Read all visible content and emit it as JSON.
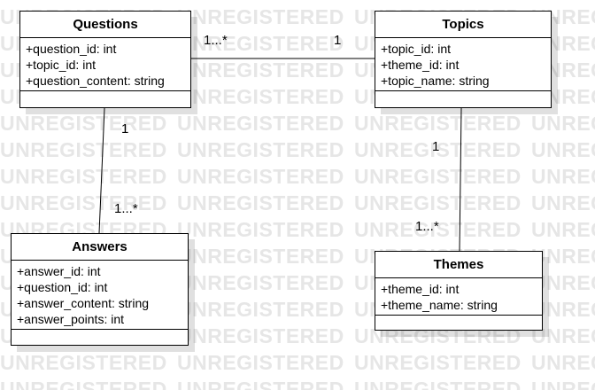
{
  "watermark_text": "UNREGISTERED",
  "classes": {
    "questions": {
      "name": "Questions",
      "attributes": [
        "+question_id: int",
        "+topic_id: int",
        "+question_content: string"
      ]
    },
    "topics": {
      "name": "Topics",
      "attributes": [
        "+topic_id: int",
        "+theme_id: int",
        "+topic_name: string"
      ]
    },
    "answers": {
      "name": "Answers",
      "attributes": [
        "+answer_id: int",
        "+question_id: int",
        "+answer_content: string",
        "+answer_points: int"
      ]
    },
    "themes": {
      "name": "Themes",
      "attributes": [
        "+theme_id: int",
        "+theme_name: string"
      ]
    }
  },
  "associations": {
    "questions_topics": {
      "from_mult": "1...*",
      "to_mult": "1"
    },
    "questions_answers": {
      "from_mult": "1",
      "to_mult": "1...*"
    },
    "topics_themes": {
      "from_mult": "1",
      "to_mult": "1...*"
    }
  }
}
